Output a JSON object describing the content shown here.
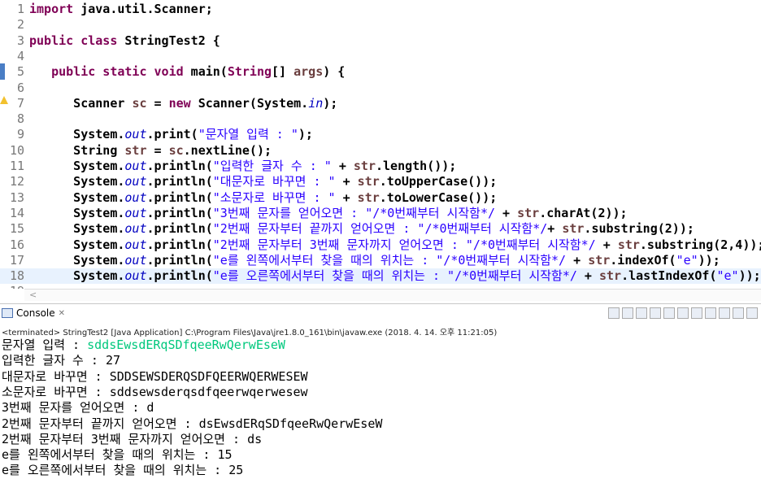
{
  "editor": {
    "lines": [
      {
        "n": "1",
        "parts": [
          {
            "t": "import",
            "c": "kw"
          },
          {
            "t": " java.util.Scanner;",
            "c": ""
          }
        ]
      },
      {
        "n": "2",
        "parts": []
      },
      {
        "n": "3",
        "parts": [
          {
            "t": "public class",
            "c": "kw"
          },
          {
            "t": " StringTest2 {",
            "c": ""
          }
        ]
      },
      {
        "n": "4",
        "parts": []
      },
      {
        "n": "5",
        "parts": [
          {
            "t": "   public static void",
            "c": "kw"
          },
          {
            "t": " main(",
            "c": ""
          },
          {
            "t": "String",
            "c": "cls"
          },
          {
            "t": "[] ",
            "c": ""
          },
          {
            "t": "args",
            "c": "var"
          },
          {
            "t": ") {",
            "c": ""
          }
        ]
      },
      {
        "n": "6",
        "parts": []
      },
      {
        "n": "7",
        "parts": [
          {
            "t": "      Scanner ",
            "c": ""
          },
          {
            "t": "sc",
            "c": "var"
          },
          {
            "t": " = ",
            "c": ""
          },
          {
            "t": "new",
            "c": "kw"
          },
          {
            "t": " Scanner(System.",
            "c": ""
          },
          {
            "t": "in",
            "c": "fld"
          },
          {
            "t": ");",
            "c": ""
          }
        ]
      },
      {
        "n": "8",
        "parts": []
      },
      {
        "n": "9",
        "parts": [
          {
            "t": "      System.",
            "c": ""
          },
          {
            "t": "out",
            "c": "fld"
          },
          {
            "t": ".print(",
            "c": ""
          },
          {
            "t": "\"문자열 입력 : \"",
            "c": "str"
          },
          {
            "t": ");",
            "c": ""
          }
        ]
      },
      {
        "n": "10",
        "parts": [
          {
            "t": "      String ",
            "c": ""
          },
          {
            "t": "str",
            "c": "var"
          },
          {
            "t": " = ",
            "c": ""
          },
          {
            "t": "sc",
            "c": "var"
          },
          {
            "t": ".nextLine();",
            "c": ""
          }
        ]
      },
      {
        "n": "11",
        "parts": [
          {
            "t": "      System.",
            "c": ""
          },
          {
            "t": "out",
            "c": "fld"
          },
          {
            "t": ".println(",
            "c": ""
          },
          {
            "t": "\"입력한 글자 수 : \"",
            "c": "str"
          },
          {
            "t": " + ",
            "c": ""
          },
          {
            "t": "str",
            "c": "var"
          },
          {
            "t": ".length());",
            "c": ""
          }
        ]
      },
      {
        "n": "12",
        "parts": [
          {
            "t": "      System.",
            "c": ""
          },
          {
            "t": "out",
            "c": "fld"
          },
          {
            "t": ".println(",
            "c": ""
          },
          {
            "t": "\"대문자로 바꾸면 : \"",
            "c": "str"
          },
          {
            "t": " + ",
            "c": ""
          },
          {
            "t": "str",
            "c": "var"
          },
          {
            "t": ".toUpperCase());",
            "c": ""
          }
        ]
      },
      {
        "n": "13",
        "parts": [
          {
            "t": "      System.",
            "c": ""
          },
          {
            "t": "out",
            "c": "fld"
          },
          {
            "t": ".println(",
            "c": ""
          },
          {
            "t": "\"소문자로 바꾸면 : \"",
            "c": "str"
          },
          {
            "t": " + ",
            "c": ""
          },
          {
            "t": "str",
            "c": "var"
          },
          {
            "t": ".toLowerCase());",
            "c": ""
          }
        ]
      },
      {
        "n": "14",
        "parts": [
          {
            "t": "      System.",
            "c": ""
          },
          {
            "t": "out",
            "c": "fld"
          },
          {
            "t": ".println(",
            "c": ""
          },
          {
            "t": "\"3번째 문자를 얻어오면 : \"",
            "c": "str"
          },
          {
            "t": "/*0번째부터 시작함*/",
            "c": "str"
          },
          {
            "t": " + ",
            "c": ""
          },
          {
            "t": "str",
            "c": "var"
          },
          {
            "t": ".charAt(2));",
            "c": ""
          }
        ]
      },
      {
        "n": "15",
        "parts": [
          {
            "t": "      System.",
            "c": ""
          },
          {
            "t": "out",
            "c": "fld"
          },
          {
            "t": ".println(",
            "c": ""
          },
          {
            "t": "\"2번째 문자부터 끝까지 얻어오면 : \"",
            "c": "str"
          },
          {
            "t": "/*0번째부터 시작함*/",
            "c": "str"
          },
          {
            "t": "+ ",
            "c": ""
          },
          {
            "t": "str",
            "c": "var"
          },
          {
            "t": ".substring(2));",
            "c": ""
          }
        ]
      },
      {
        "n": "16",
        "parts": [
          {
            "t": "      System.",
            "c": ""
          },
          {
            "t": "out",
            "c": "fld"
          },
          {
            "t": ".println(",
            "c": ""
          },
          {
            "t": "\"2번째 문자부터 3번째 문자까지 얻어오면 : \"",
            "c": "str"
          },
          {
            "t": "/*0번째부터 시작함*/",
            "c": "str"
          },
          {
            "t": " + ",
            "c": ""
          },
          {
            "t": "str",
            "c": "var"
          },
          {
            "t": ".substring(2,4));",
            "c": ""
          }
        ]
      },
      {
        "n": "17",
        "parts": [
          {
            "t": "      System.",
            "c": ""
          },
          {
            "t": "out",
            "c": "fld"
          },
          {
            "t": ".println(",
            "c": ""
          },
          {
            "t": "\"e를 왼쪽에서부터 찾을 때의 위치는 : \"",
            "c": "str"
          },
          {
            "t": "/*0번째부터 시작함*/",
            "c": "str"
          },
          {
            "t": " + ",
            "c": ""
          },
          {
            "t": "str",
            "c": "var"
          },
          {
            "t": ".indexOf(",
            "c": ""
          },
          {
            "t": "\"e\"",
            "c": "str"
          },
          {
            "t": "));",
            "c": ""
          }
        ]
      },
      {
        "n": "18",
        "parts": [
          {
            "t": "      System.",
            "c": ""
          },
          {
            "t": "out",
            "c": "fld"
          },
          {
            "t": ".println(",
            "c": ""
          },
          {
            "t": "\"e를 오른쪽에서부터 찾을 때의 위치는 : \"",
            "c": "str"
          },
          {
            "t": "/*0번째부터 시작함*/",
            "c": "str"
          },
          {
            "t": " + ",
            "c": ""
          },
          {
            "t": "str",
            "c": "var"
          },
          {
            "t": ".lastIndexOf(",
            "c": ""
          },
          {
            "t": "\"e\"",
            "c": "str"
          },
          {
            "t": "));",
            "c": ""
          }
        ]
      },
      {
        "n": "19",
        "parts": []
      }
    ],
    "current_line": "18"
  },
  "console": {
    "tab_label": "Console",
    "close_glyph": "✕",
    "terminated": "<terminated> StringTest2 [Java Application] C:\\Program Files\\Java\\jre1.8.0_161\\bin\\javaw.exe (2018. 4. 14. 오후 11:21:05)",
    "output": [
      {
        "prompt": "문자열 입력 : ",
        "input": "sddsEwsdERqSDfqeeRwQerwEseW"
      },
      {
        "prompt": "입력한 글자 수 : 27",
        "input": ""
      },
      {
        "prompt": "대문자로 바꾸면 : SDDSEWSDERQSDFQEERWQERWESEW",
        "input": ""
      },
      {
        "prompt": "소문자로 바꾸면 : sddsewsderqsdfqeerwqerwesew",
        "input": ""
      },
      {
        "prompt": "3번째 문자를 얻어오면 : d",
        "input": ""
      },
      {
        "prompt": "2번째 문자부터 끝까지 얻어오면 : dsEwsdERqSDfqeeRwQerwEseW",
        "input": ""
      },
      {
        "prompt": "2번째 문자부터 3번째 문자까지 얻어오면 : ds",
        "input": ""
      },
      {
        "prompt": "e를 왼쪽에서부터 찾을 때의 위치는 : 15",
        "input": ""
      },
      {
        "prompt": "e를 오른쪽에서부터 찾을 때의 위치는 : 25",
        "input": ""
      }
    ],
    "toolbar_icons": [
      "terminate-icon",
      "remove-launch-icon",
      "remove-all-icon",
      "scroll-lock-icon",
      "show-console-stdout-icon",
      "show-console-stderr-icon",
      "pin-console-icon",
      "display-console-icon",
      "open-console-icon",
      "minimize-icon",
      "maximize-icon"
    ]
  }
}
